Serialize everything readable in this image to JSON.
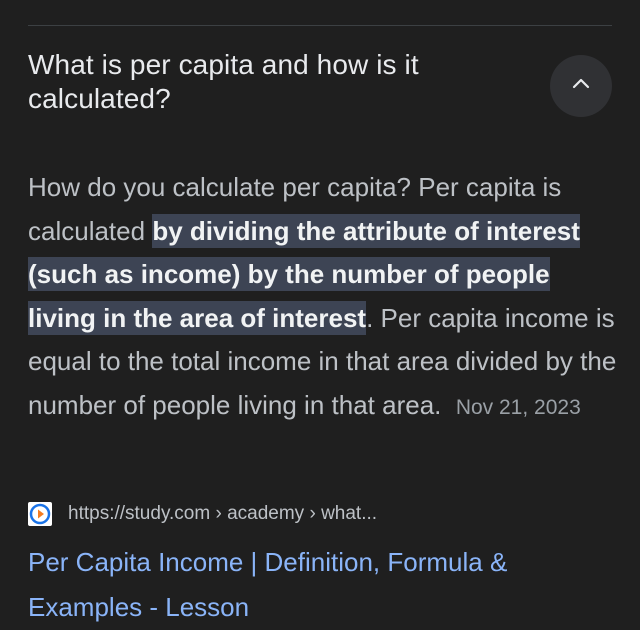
{
  "question": {
    "title": "What is per capita and how is it calculated?"
  },
  "answer": {
    "intro": "How do you calculate per capita? Per capita is calculated ",
    "highlight": "by dividing the attribute of interest (such as income) by the number of people living in the area of interest",
    "rest": ". Per capita income is equal to the total income in that area divided by the number of people living in that area.",
    "date": "Nov 21, 2023"
  },
  "source": {
    "url": "https://study.com › academy › what..."
  },
  "result": {
    "title": "Per Capita Income | Definition, Formula & Examples - Lesson"
  },
  "colors": {
    "background": "#1f1f1f",
    "highlight": "#3d4454",
    "link": "#8ab4f8"
  },
  "icons": {
    "collapse": "chevron-up-icon",
    "favicon": "study-com-favicon-icon"
  }
}
